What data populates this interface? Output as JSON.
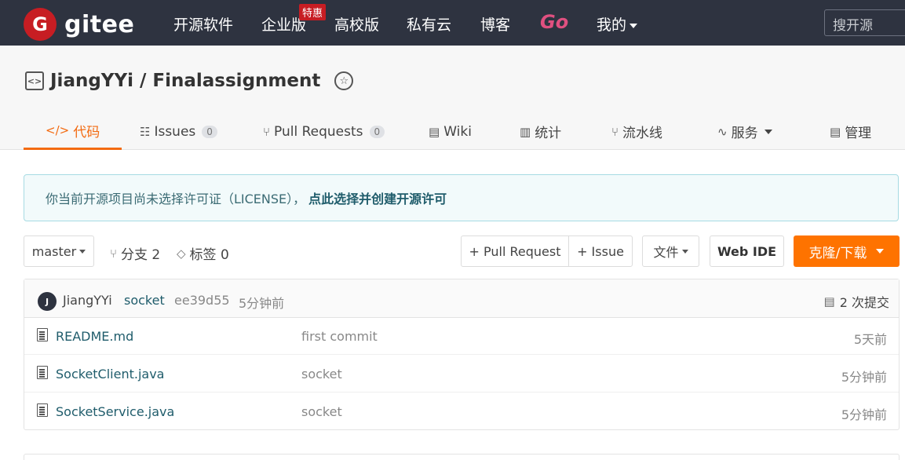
{
  "topnav": {
    "logo_glyph": "G",
    "logo_text": "gitee",
    "items": [
      "开源软件",
      "企业版",
      "高校版",
      "私有云",
      "博客"
    ],
    "promo_badge": "特惠",
    "go_label": "Go",
    "mine_label": "我的",
    "search_placeholder": "搜开源"
  },
  "repo": {
    "owner_repo": "JiangYYi / Finalassignment"
  },
  "tabs": [
    {
      "label": "代码",
      "icon": "code-icon"
    },
    {
      "label": "Issues",
      "count": "0",
      "icon": "issues-icon"
    },
    {
      "label": "Pull Requests",
      "count": "0",
      "icon": "pull-request-icon"
    },
    {
      "label": "Wiki",
      "icon": "book-icon"
    },
    {
      "label": "统计",
      "icon": "chart-icon"
    },
    {
      "label": "流水线",
      "icon": "pipeline-icon"
    },
    {
      "label": "服务",
      "icon": "pulse-icon"
    },
    {
      "label": "管理",
      "icon": "settings-doc-icon"
    }
  ],
  "notice": {
    "text": "你当前开源项目尚未选择许可证（LICENSE），",
    "link": "点此选择并创建开源许可"
  },
  "actions": {
    "branch": "master",
    "branches": "分支 2",
    "tags": "标签 0",
    "pull_request": "+ Pull Request",
    "issue": "+ Issue",
    "file": "文件",
    "webide": "Web IDE",
    "clone": "克隆/下载"
  },
  "commit": {
    "avatar_letter": "J",
    "author": "JiangYYi",
    "message": "socket",
    "hash": "ee39d55",
    "time": "5分钟前",
    "count": "2 次提交"
  },
  "files": [
    {
      "name": "README.md",
      "message": "first commit",
      "time": "5天前"
    },
    {
      "name": "SocketClient.java",
      "message": "socket",
      "time": "5分钟前"
    },
    {
      "name": "SocketService.java",
      "message": "socket",
      "time": "5分钟前"
    }
  ],
  "colors": {
    "nav_bg": "#2e3340",
    "brand_red": "#c71d23",
    "accent_orange": "#fe7300",
    "link_teal": "#1f5c6b"
  }
}
